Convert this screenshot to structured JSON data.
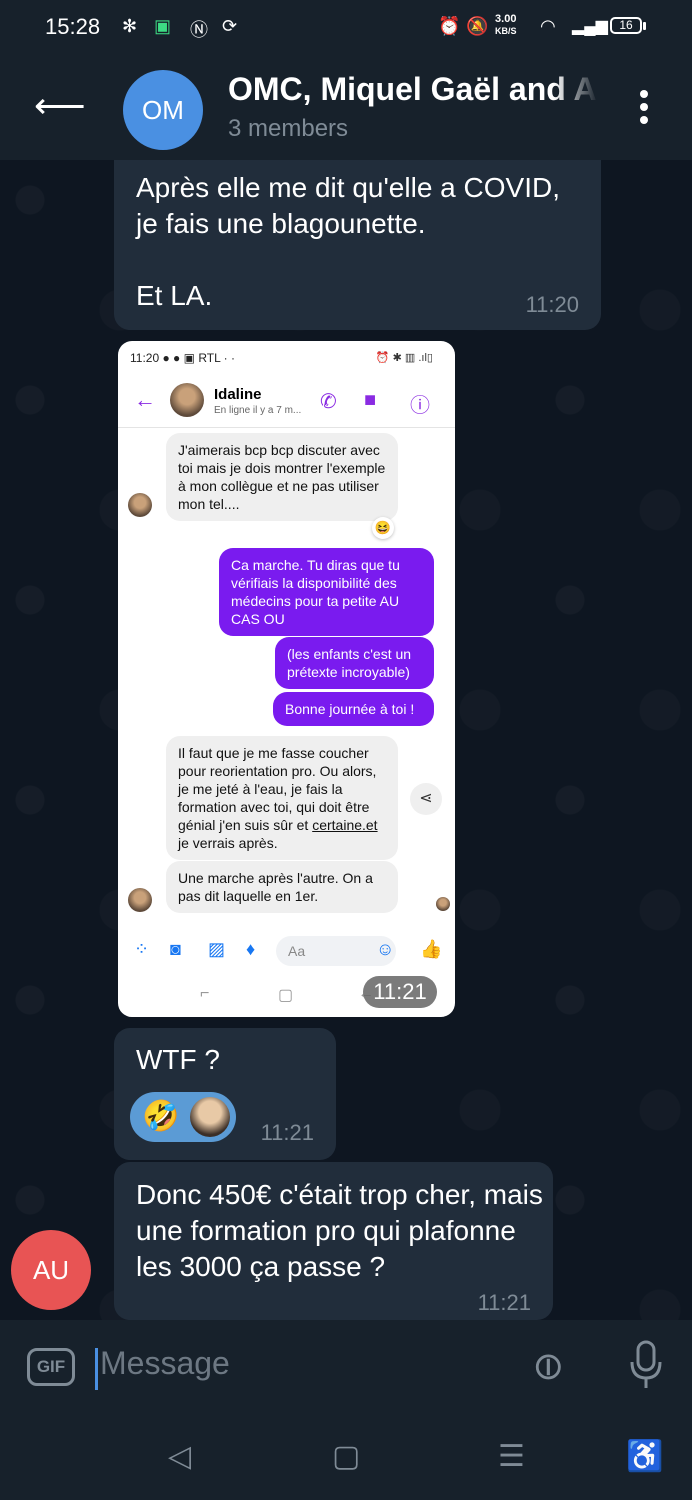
{
  "status_bar": {
    "time": "15:28",
    "speed_value": "3.00",
    "speed_unit": "KB/S",
    "battery": "16"
  },
  "header": {
    "avatar_initials": "OM",
    "title": "OMC, Miquel Gaël and A",
    "subtitle": "3 members"
  },
  "messages": [
    {
      "text": "Après elle me dit qu'elle a COVID, je fais une blagounette.\n\nEt LA.",
      "time": "11:20"
    },
    {
      "type": "screenshot",
      "time": "11:21"
    },
    {
      "text": "WTF ?",
      "time": "11:21",
      "reaction_emoji": "🤣"
    },
    {
      "text": "Donc 450€ c'était trop cher, mais une formation pro qui plafonne les 3000 ça passe ?",
      "time": "11:21",
      "sender_initials": "AU"
    }
  ],
  "screenshot": {
    "status_time": "11:20",
    "status_label": "RTL",
    "contact_name": "Idaline",
    "contact_status": "En ligne il y a 7 m...",
    "reaction": "😆",
    "messages": [
      "J'aimerais bcp bcp discuter avec toi mais je dois montrer l'exemple à mon collègue et ne pas utiliser mon tel....",
      "Ca marche. Tu diras que tu vérifiais la disponibilité des médecins pour ta petite AU CAS OU",
      "(les enfants c'est un prétexte incroyable)",
      "Bonne journée à toi !",
      "Il faut que je me fasse coucher pour reorientation pro. Ou alors, je me jeté à l'eau, je fais la formation avec toi, qui doit être génial j'en suis sûr et ",
      "Une marche après l'autre. On a pas dit laquelle en 1er."
    ],
    "link_text": "certaine.et",
    "link_suffix": " je verrais après.",
    "composer_placeholder": "Aa"
  },
  "input": {
    "gif_label": "GIF",
    "placeholder": "Message"
  },
  "colors": {
    "header_bg": "#17212b",
    "chat_bg": "#0e1621",
    "bubble_in": "#212d3b",
    "avatar_om": "#4a90e2",
    "avatar_au": "#e85454",
    "messenger_sent": "#7a1bef"
  }
}
